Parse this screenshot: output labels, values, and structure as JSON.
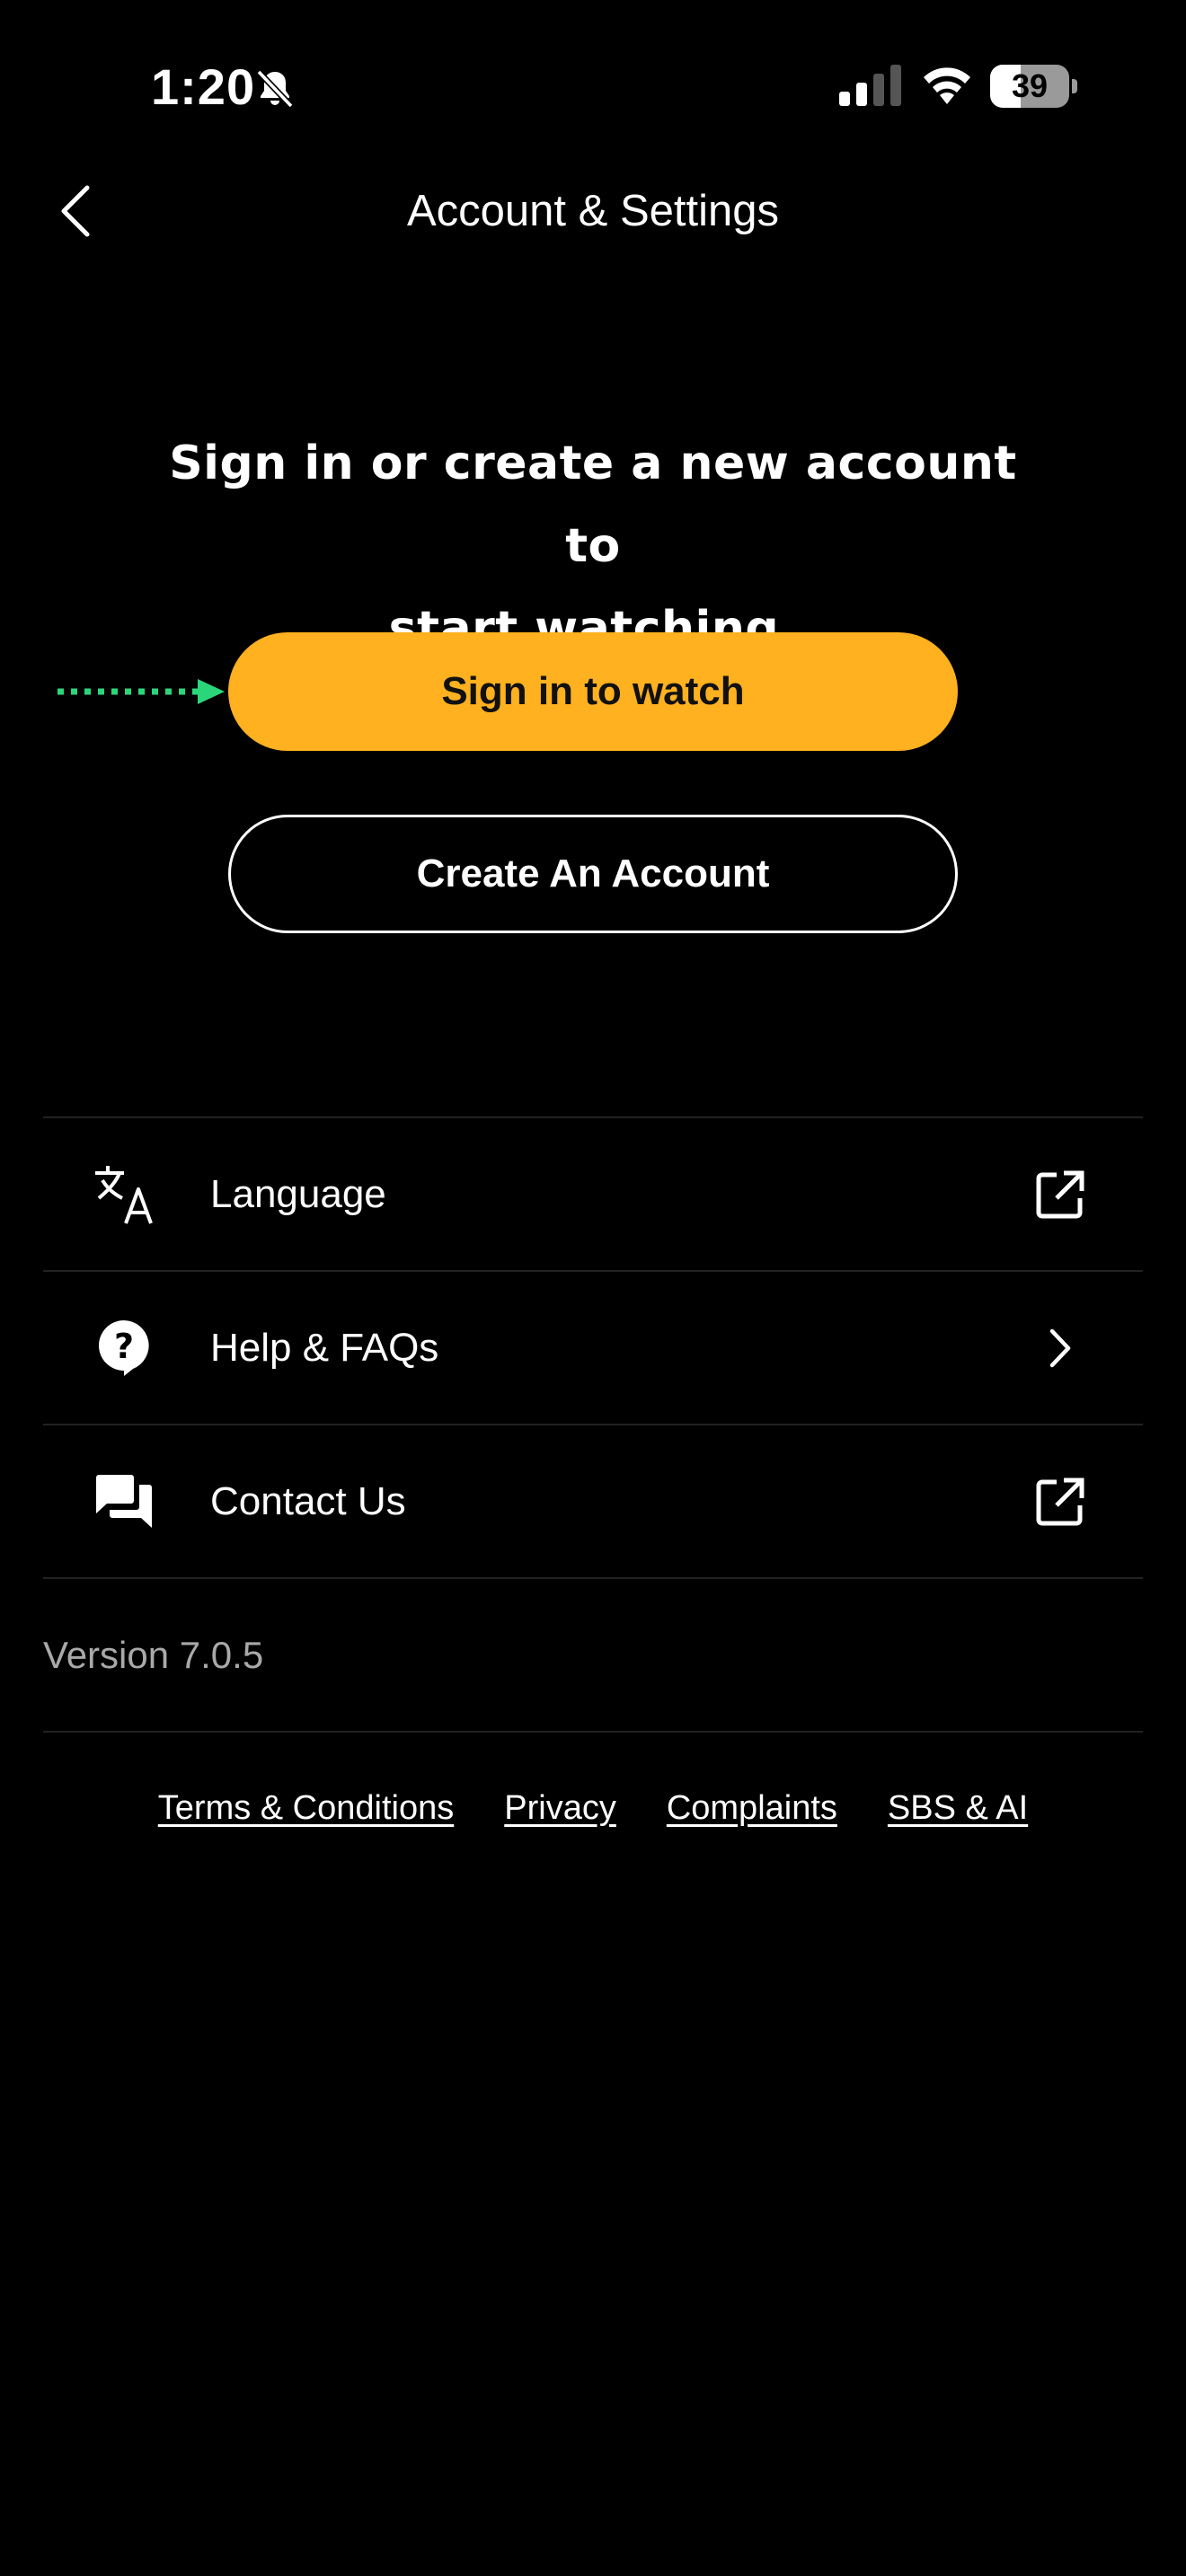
{
  "status_bar": {
    "time": "1:20",
    "battery_percent": "39",
    "battery_level": 0.39,
    "icons": [
      "bell-slash-icon",
      "cellular-signal-icon",
      "wifi-icon",
      "battery-icon"
    ]
  },
  "header": {
    "title": "Account & Settings",
    "back_icon": "chevron-left-icon"
  },
  "signin": {
    "prompt_line1": "Sign in or create a new account to",
    "prompt_line2": "start watching.",
    "primary_button": "Sign in to watch",
    "secondary_button": "Create An Account",
    "pointer_icon": "dotted-arrow-right-icon"
  },
  "menu": {
    "items": [
      {
        "label": "Language",
        "icon": "translate-icon",
        "trailing_icon": "external-link-icon"
      },
      {
        "label": "Help & FAQs",
        "icon": "help-bubble-icon",
        "trailing_icon": "chevron-right-icon"
      },
      {
        "label": "Contact Us",
        "icon": "chat-bubbles-icon",
        "trailing_icon": "external-link-icon"
      }
    ],
    "version": "Version 7.0.5"
  },
  "footer": {
    "links": [
      "Terms & Conditions",
      "Privacy",
      "Complaints",
      "SBS & AI"
    ]
  },
  "colors": {
    "background": "#000000",
    "accent": "#FFB11F",
    "pointer": "#2BD67B",
    "muted_text": "#A9A9A9",
    "divider": "#222222"
  }
}
